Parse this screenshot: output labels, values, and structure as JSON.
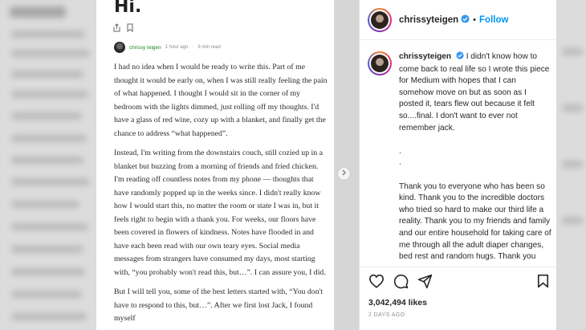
{
  "article": {
    "title": "Hi.",
    "author": "chrissy teigen",
    "time": "1 hour ago",
    "separator": "·",
    "read_time": "8 min read",
    "paragraphs": [
      "I had no idea when I would be ready to write this. Part of me thought it would be early on, when I was still really feeling the pain of what happened. I thought I would sit in the corner of my bedroom with the lights dimmed, just rolling off my thoughts. I'd have a glass of red wine, cozy up with a blanket, and finally get the chance to address “what happened”.",
      "Instead, I'm writing from the downstairs couch, still cozied up in a blanket but buzzing from a morning of friends and fried chicken. I'm reading off countless notes from my phone — thoughts that have randomly popped up in the weeks since. I didn't really know how I would start this, no matter the room or state I was in, but it feels right to begin with a thank you. For weeks, our floors have been covered in flowers of kindness. Notes have flooded in and have each been read with our own teary eyes. Social media messages from strangers have consumed my days, most starting with, “you probably won't read this, but…”. I can assure you, I did.",
      "But I will tell you, some of the best letters started with, “You don't have to respond to this, but…”. After we first lost Jack, I found myself"
    ]
  },
  "post": {
    "username": "chrissyteigen",
    "follow_label": "Follow",
    "dot": "•",
    "caption_lines": [
      "I didn't know how to come back to real life so I wrote this piece for Medium with hopes that I can somehow move on but as soon as I posted it, tears flew out because it felt so....final. I don't want to ever not remember jack.",
      ".",
      ".",
      "Thank you to everyone who has been so kind. Thank you to the incredible doctors who tried so hard to make our third life a reality. Thank you to my friends and family and our entire household for taking care of me through all the adult diaper changes, bed rest and random hugs. Thank you John for being my best friend and love of my life. A lot of people think of the ... my priorities ... like this but I will"
    ],
    "likes": "3,042,494 likes",
    "timestamp": "2 DAYS AGO"
  },
  "icons": {
    "like": "heart-icon",
    "comment": "comment-icon",
    "share": "share-icon",
    "save": "bookmark-icon",
    "verified": "verified-badge-icon",
    "clap": "share-article-icon",
    "bookmark_article": "bookmark-article-icon",
    "next": "chevron-right-icon"
  },
  "colors": {
    "follow": "#0095f6",
    "verified": "#3897f0",
    "author": "#1a8917"
  }
}
